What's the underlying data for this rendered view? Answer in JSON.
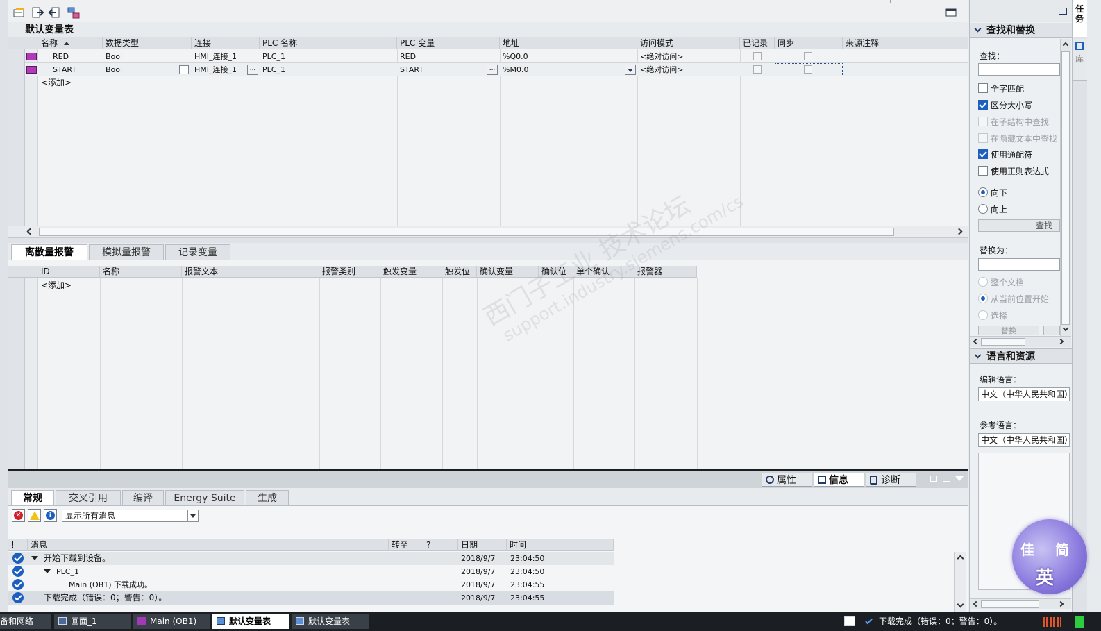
{
  "tag_table": {
    "title": "默认变量表",
    "columns": [
      "名称",
      "数据类型",
      "连接",
      "PLC 名称",
      "PLC 变量",
      "地址",
      "访问模式",
      "已记录",
      "同步",
      "来源注释"
    ],
    "rows": [
      {
        "name": "RED",
        "type": "Bool",
        "connection": "HMI_连接_1",
        "plc_name": "PLC_1",
        "plc_tag": "RED",
        "address": "%Q0.0",
        "access": "<绝对访问>"
      },
      {
        "name": "START",
        "type": "Bool",
        "connection": "HMI_连接_1",
        "plc_name": "PLC_1",
        "plc_tag": "START",
        "address": "%M0.0",
        "access": "<绝对访问>"
      }
    ],
    "add_label": "<添加>",
    "ellipsis": "..."
  },
  "alarm_tabs": [
    "离散量报警",
    "模拟量报警",
    "记录变量"
  ],
  "alarm_table": {
    "columns": [
      "ID",
      "名称",
      "报警文本",
      "报警类别",
      "触发变量",
      "触发位",
      "确认变量",
      "确认位",
      "单个确认",
      "报警器"
    ],
    "add_label": "<添加>"
  },
  "inspector_tabs": [
    "属性",
    "信息",
    "诊断"
  ],
  "info_tabs": [
    "常规",
    "交叉引用",
    "编译",
    "Energy Suite",
    "生成"
  ],
  "filter": {
    "selected": "显示所有消息"
  },
  "messages": {
    "columns": [
      "!",
      "消息",
      "转至",
      "?",
      "日期",
      "时间"
    ],
    "rows": [
      {
        "text": "开始下载到设备。",
        "date": "2018/9/7",
        "time": "23:04:50"
      },
      {
        "text": "PLC_1",
        "date": "2018/9/7",
        "time": "23:04:50"
      },
      {
        "text": "Main (OB1) 下载成功。",
        "date": "2018/9/7",
        "time": "23:04:55"
      },
      {
        "text": "下载完成（错误：0；警告：0）。",
        "date": "2018/9/7",
        "time": "23:04:55"
      }
    ]
  },
  "find_replace": {
    "title": "查找和替换",
    "find_label": "查找：",
    "options": [
      {
        "label": "全字匹配",
        "checked": false,
        "disabled": false
      },
      {
        "label": "区分大小写",
        "checked": true,
        "disabled": false
      },
      {
        "label": "在子结构中查找",
        "checked": false,
        "disabled": true
      },
      {
        "label": "在隐藏文本中查找",
        "checked": false,
        "disabled": true
      },
      {
        "label": "使用通配符",
        "checked": true,
        "disabled": false
      },
      {
        "label": "使用正则表达式",
        "checked": false,
        "disabled": false
      }
    ],
    "down": "向下",
    "up": "向上",
    "find_button": "查找",
    "replace_label": "替换为：",
    "scope": [
      "整个文档",
      "从当前位置开始",
      "选择"
    ],
    "replace_button": "替换"
  },
  "language": {
    "title": "语言和资源",
    "edit_label": "编辑语言：",
    "edit_value": "中文（中华人民共和国）",
    "ref_label": "参考语言：",
    "ref_value": "中文（中华人民共和国）"
  },
  "right_tabs": [
    "任务",
    "库"
  ],
  "taskbar": {
    "items": [
      "备和网络",
      "画面_1",
      "Main (OB1)",
      "默认变量表",
      "默认变量表"
    ],
    "status": "下载完成（错误：0；警告：0）。"
  },
  "watermark": {
    "line1": "西门子工业 技术论坛",
    "line2": "support.industry.siemens.com/cs"
  },
  "logo_text": [
    "佳",
    "简",
    "英"
  ],
  "colors": {
    "accent": "#1d5fbf",
    "taskbar": "#1b1f24",
    "header": "#dde1e5",
    "panel": "#edf0f2"
  }
}
